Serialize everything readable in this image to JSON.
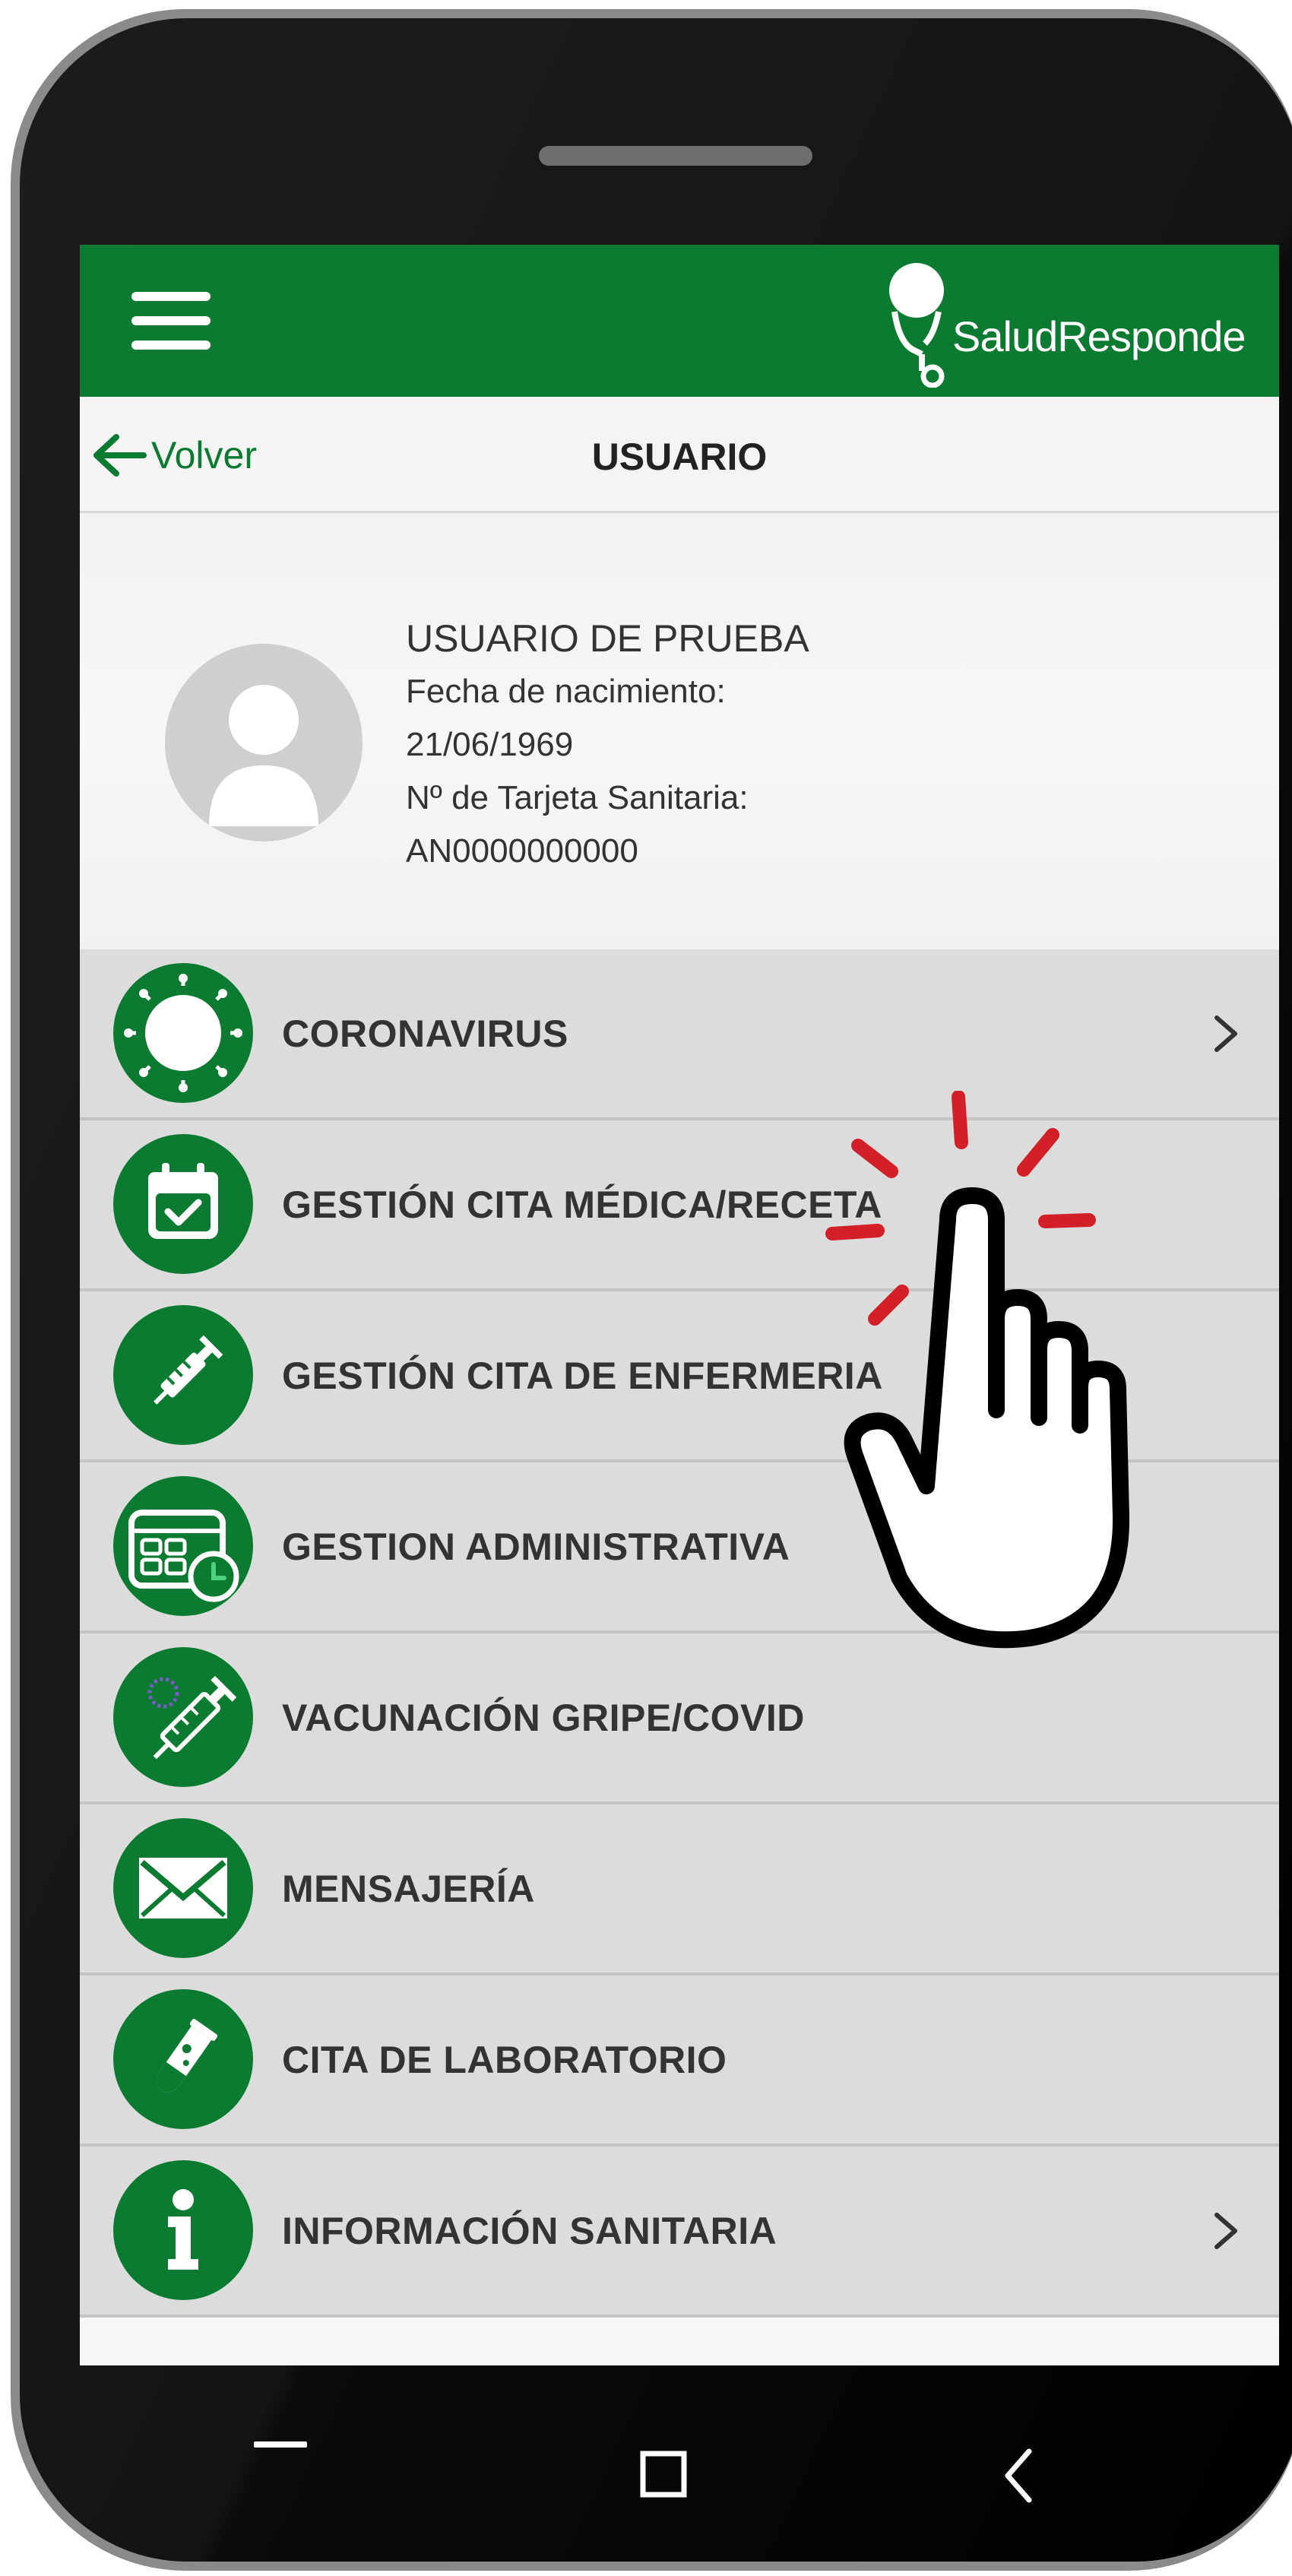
{
  "header": {
    "menu_icon": "hamburger-icon",
    "logo_text": "SaludResponde",
    "logo_icon": "stethoscope-icon"
  },
  "title_bar": {
    "back_label": "Volver",
    "title": "USUARIO"
  },
  "user": {
    "name": "USUARIO DE PRUEBA",
    "birth_label": "Fecha de nacimiento:",
    "birth_date": "21/06/1969",
    "card_label": "Nº de Tarjeta Sanitaria:",
    "card_number": "AN0000000000"
  },
  "menu": [
    {
      "label": "CORONAVIRUS",
      "icon": "virus-icon",
      "chevron": true
    },
    {
      "label": "GESTIÓN CITA MÉDICA/RECETA",
      "icon": "calendar-check-icon",
      "chevron": false
    },
    {
      "label": "GESTIÓN CITA DE ENFERMERIA",
      "icon": "syringe-icon",
      "chevron": false
    },
    {
      "label": "GESTION ADMINISTRATIVA",
      "icon": "calendar-clock-icon",
      "chevron": false
    },
    {
      "label": "VACUNACIÓN GRIPE/COVID",
      "icon": "vaccine-icon",
      "chevron": false
    },
    {
      "label": "MENSAJERÍA",
      "icon": "envelope-icon",
      "chevron": false
    },
    {
      "label": "CITA DE LABORATORIO",
      "icon": "test-tube-icon",
      "chevron": false
    },
    {
      "label": "INFORMACIÓN SANITARIA",
      "icon": "info-icon",
      "chevron": true
    }
  ],
  "colors": {
    "brand_green": "#0c7a32",
    "menu_bg": "#dcdcdc",
    "tap_accent": "#d31f2a"
  }
}
